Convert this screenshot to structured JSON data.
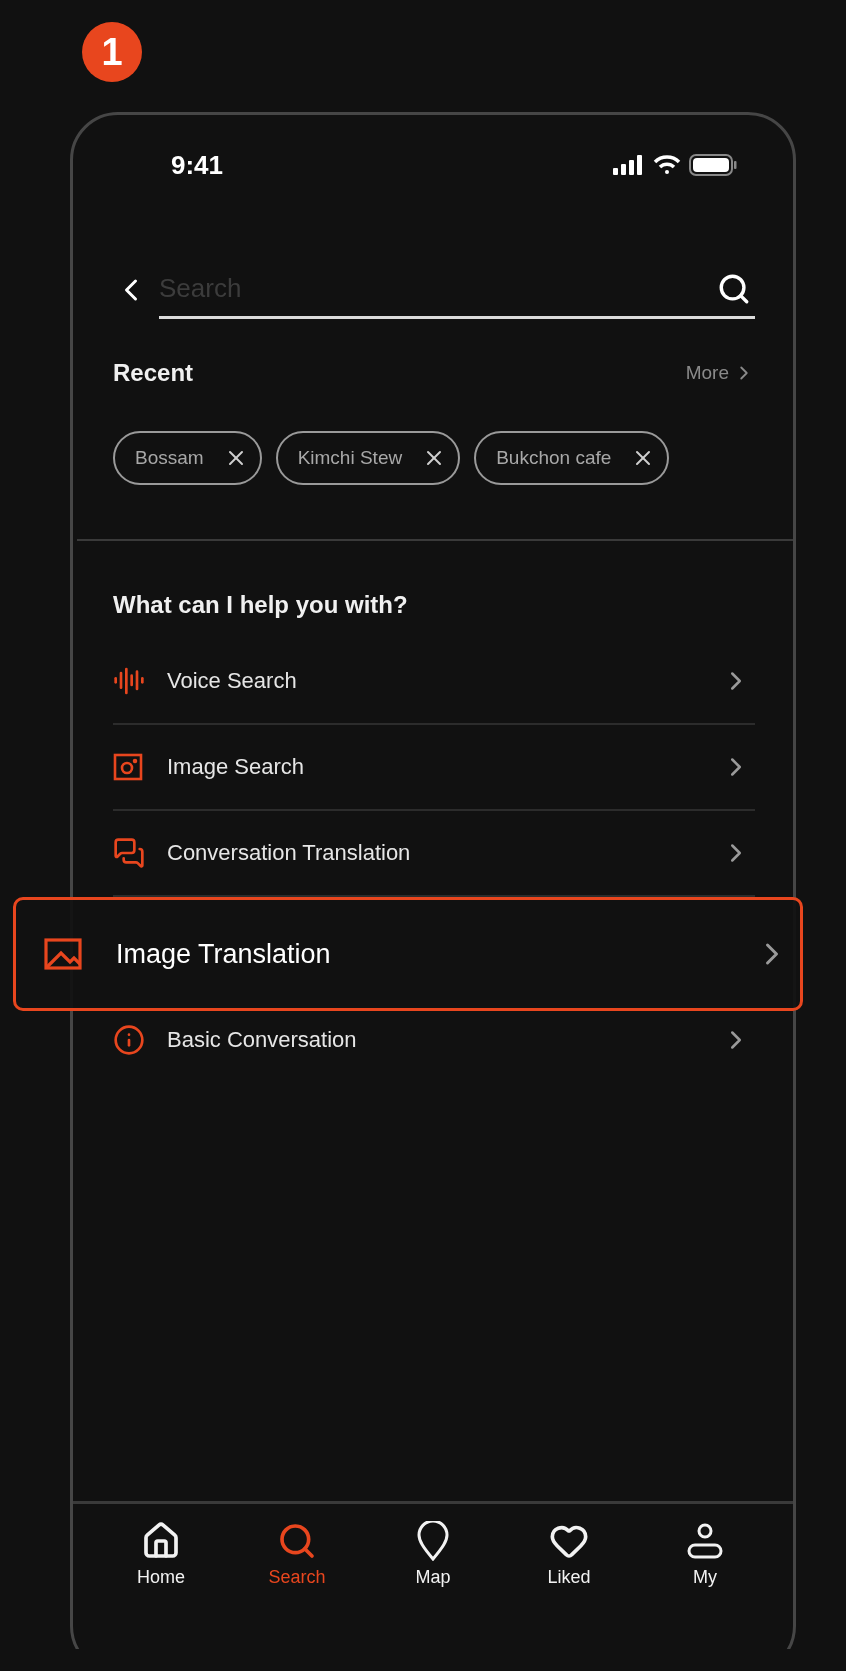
{
  "step_badge": "1",
  "status_bar": {
    "time": "9:41"
  },
  "search": {
    "placeholder": "Search"
  },
  "recent": {
    "title": "Recent",
    "more": "More",
    "chips": [
      "Bossam",
      "Kimchi Stew",
      "Bukchon cafe"
    ]
  },
  "help": {
    "title": "What can I help you with?",
    "items": [
      {
        "kind": "voice",
        "label": "Voice Search",
        "highlighted": false
      },
      {
        "kind": "image-search",
        "label": "Image Search",
        "highlighted": false
      },
      {
        "kind": "conversation",
        "label": "Conversation Translation",
        "highlighted": false
      },
      {
        "kind": "image",
        "label": "Image Translation",
        "highlighted": true
      },
      {
        "kind": "info",
        "label": "Basic Conversation",
        "highlighted": false
      }
    ]
  },
  "tabs": [
    {
      "kind": "home",
      "label": "Home",
      "selected": false
    },
    {
      "kind": "search",
      "label": "Search",
      "selected": true
    },
    {
      "kind": "map",
      "label": "Map",
      "selected": false
    },
    {
      "kind": "liked",
      "label": "Liked",
      "selected": false
    },
    {
      "kind": "my",
      "label": "My",
      "selected": false
    }
  ]
}
